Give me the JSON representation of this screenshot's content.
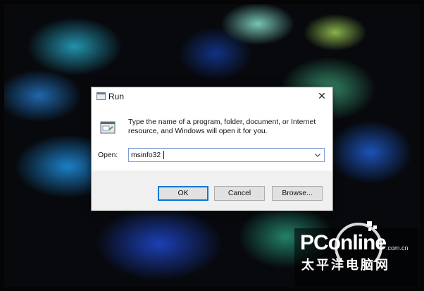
{
  "dialog": {
    "title": "Run",
    "description": "Type the name of a program, folder, document, or Internet resource, and Windows will open it for you.",
    "open_label": "Open:",
    "open_value": "msinfo32",
    "ok_label": "OK",
    "cancel_label": "Cancel",
    "browse_label": "Browse...",
    "close_glyph": "✕"
  },
  "icons": {
    "title": "run-app-icon",
    "body": "run-window-icon",
    "dropdown": "chevron-down-icon",
    "close": "close-icon"
  },
  "watermark": {
    "logo": "PConline",
    "domain": ".com.cn",
    "cn_text": "太平洋电脑网"
  },
  "colors": {
    "default_button_border": "#0078d7",
    "input_border": "#7a9fd6",
    "footer_bg": "#f0f0f0"
  }
}
